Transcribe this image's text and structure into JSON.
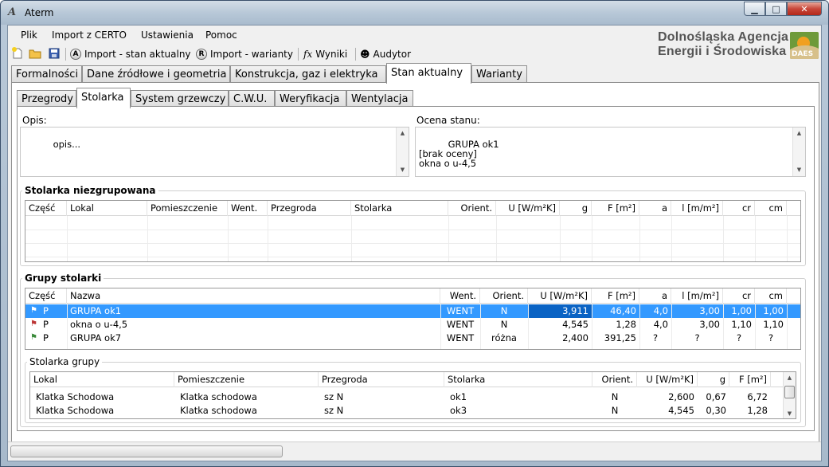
{
  "window": {
    "title": "Aterm"
  },
  "menu": [
    "Plik",
    "Import z CERTO",
    "Ustawienia",
    "Pomoc"
  ],
  "toolbar": {
    "import_current": "Import - stan aktualny",
    "import_variants": "Import - warianty",
    "results": "Wyniki",
    "auditor": "Audytor"
  },
  "logo": {
    "line1": "Dolnośląska Agencja",
    "line2": "Energii i Środowiska",
    "badge": "DAES"
  },
  "main_tabs": [
    "Formalności",
    "Dane źródłowe i geometria",
    "Konstrukcja, gaz i elektryka",
    "Stan aktualny",
    "Warianty"
  ],
  "sub_tabs": [
    "Przegrody",
    "Stolarka",
    "System grzewczy",
    "C.W.U.",
    "Weryfikacja",
    "Wentylacja"
  ],
  "description": {
    "label": "Opis:",
    "value": "opis..."
  },
  "assessment": {
    "label": "Ocena stanu:",
    "value": "GRUPA ok1\n[brak oceny]\nokna o u-4,5"
  },
  "ungrouped": {
    "title": "Stolarka niezgrupowana",
    "columns": [
      "Część",
      "Lokal",
      "Pomieszczenie",
      "Went.",
      "Przegroda",
      "Stolarka",
      "Orient.",
      "U [W/m²K]",
      "g",
      "F [m²]",
      "a",
      "l [m/m²]",
      "cr",
      "cm"
    ]
  },
  "groups": {
    "title": "Grupy stolarki",
    "columns": [
      "Część",
      "Nazwa",
      "Went.",
      "Orient.",
      "U [W/m²K]",
      "F [m²]",
      "a",
      "l [m/m²]",
      "cr",
      "cm"
    ],
    "rows": [
      [
        "P",
        "GRUPA ok1",
        "WENT",
        "N",
        "3,911",
        "46,40",
        "4,0",
        "3,00",
        "1,00",
        "1,00"
      ],
      [
        "P",
        "okna o u-4,5",
        "WENT",
        "N",
        "4,545",
        "1,28",
        "4,0",
        "3,00",
        "1,10",
        "1,10"
      ],
      [
        "P",
        "GRUPA ok7",
        "WENT",
        "różna",
        "2,400",
        "391,25",
        "?",
        "?",
        "?",
        "?"
      ]
    ]
  },
  "group_items": {
    "title": "Stolarka grupy",
    "columns": [
      "Lokal",
      "Pomieszczenie",
      "Przegroda",
      "Stolarka",
      "Orient.",
      "U [W/m²K]",
      "g",
      "F [m²]"
    ],
    "rows": [
      [
        "Klatka Schodowa",
        "Klatka schodowa",
        "sz N",
        "ok1",
        "N",
        "2,600",
        "0,67",
        "6,72"
      ],
      [
        "Klatka Schodowa",
        "Klatka schodowa",
        "sz N",
        "ok3",
        "N",
        "4,545",
        "0,30",
        "1,28"
      ]
    ]
  }
}
